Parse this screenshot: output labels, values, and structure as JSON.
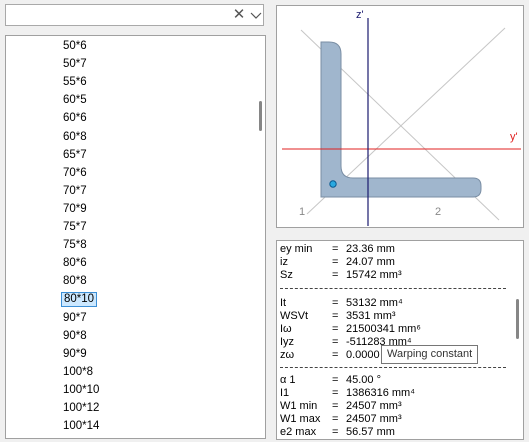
{
  "search": {
    "value": "",
    "clear_glyph": "✕"
  },
  "list": {
    "items": [
      "50*6",
      "50*7",
      "55*6",
      "60*5",
      "60*6",
      "60*8",
      "65*7",
      "70*6",
      "70*7",
      "70*9",
      "75*7",
      "75*8",
      "80*6",
      "80*8",
      "80*10",
      "90*7",
      "90*8",
      "90*9",
      "100*8",
      "100*10",
      "100*12",
      "100*14"
    ],
    "selected": "80*10"
  },
  "preview": {
    "axis_z": "z'",
    "axis_y": "y'",
    "label_1": "1",
    "label_2": "2",
    "colors": {
      "section_fill": "#a0b6cd",
      "section_stroke": "#7a8ea4",
      "y_axis": "#e02020",
      "z_axis": "#1a1a6e",
      "centroid": "#2aa9e0"
    }
  },
  "properties": {
    "group1": [
      {
        "key": "ey min",
        "eq": "=",
        "value": "23.36 mm"
      },
      {
        "key": "iz",
        "eq": "=",
        "value": "24.07 mm"
      },
      {
        "key": "Sz",
        "eq": "=",
        "value": "15742 mm³"
      }
    ],
    "group2": [
      {
        "key": "It",
        "eq": "=",
        "value": "53132 mm⁴"
      },
      {
        "key": "WSVt",
        "eq": "=",
        "value": "3531 mm³"
      },
      {
        "key": "Iω",
        "eq": "=",
        "value": "21500341 mm⁶"
      },
      {
        "key": "Iyz",
        "eq": "=",
        "value": "-511283 mm⁴"
      },
      {
        "key": "zω",
        "eq": "=",
        "value": "0.0000"
      }
    ],
    "group3": [
      {
        "key": "α 1",
        "eq": "=",
        "value": "45.00 °"
      },
      {
        "key": "I1",
        "eq": "=",
        "value": "1386316 mm⁴"
      },
      {
        "key": "W1 min",
        "eq": "=",
        "value": "24507 mm³"
      },
      {
        "key": "W1 max",
        "eq": "=",
        "value": "24507 mm³"
      },
      {
        "key": "e2 max",
        "eq": "=",
        "value": "56.57 mm"
      }
    ]
  },
  "tooltip": {
    "text": "Warping constant"
  }
}
